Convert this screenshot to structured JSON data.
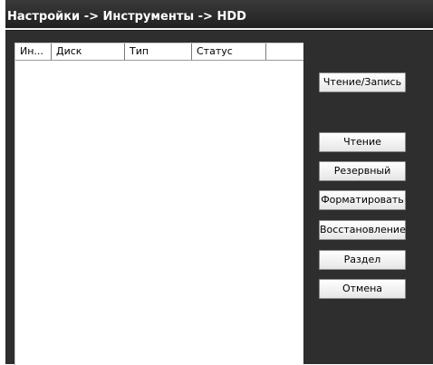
{
  "window": {
    "title": "Настройки -> Инструменты -> HDD"
  },
  "table": {
    "columns": [
      "Ин...",
      "Диск",
      "Тип",
      "Статус",
      ""
    ],
    "rows": []
  },
  "buttons": {
    "read_write": "Чтение/Запись",
    "read": "Чтение",
    "backup": "Резервный",
    "format": "Форматировать",
    "restore": "Восстановление",
    "partition": "Раздел",
    "cancel": "Отмена"
  }
}
